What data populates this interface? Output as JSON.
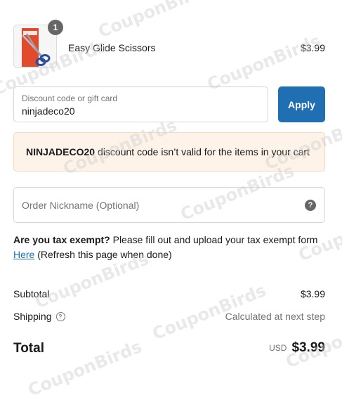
{
  "watermark": "CouponBirds",
  "product": {
    "quantity": "1",
    "name": "Easy Glide Scissors",
    "price": "$3.99"
  },
  "discount": {
    "label": "Discount code or gift card",
    "value": "ninjadeco20",
    "apply_label": "Apply"
  },
  "alert": {
    "code": "NINJADECO20",
    "message": "discount code isn’t valid for the items in your cart"
  },
  "nickname": {
    "placeholder": "Order Nickname (Optional)"
  },
  "tax": {
    "question": "Are you tax exempt?",
    "text": "Please fill out and upload your tax exempt form",
    "link_label": "Here",
    "after_link": "(Refresh this page when done)"
  },
  "summary": {
    "subtotal_label": "Subtotal",
    "subtotal_value": "$3.99",
    "shipping_label": "Shipping",
    "shipping_value": "Calculated at next step",
    "total_label": "Total",
    "currency": "USD",
    "total_value": "$3.99"
  },
  "colors": {
    "primary": "#1f6fb2",
    "alert_bg": "#fef3e8",
    "alert_border": "#f7d9bc"
  }
}
